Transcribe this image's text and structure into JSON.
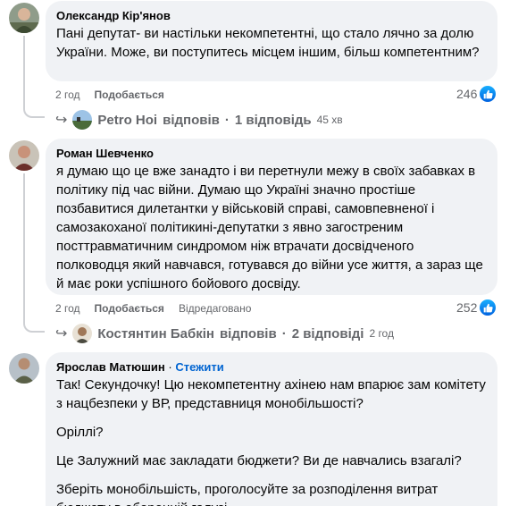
{
  "comments": [
    {
      "author": "Олександр Кір'янов",
      "text": [
        "Пані депутат- ви настільки некомпетентні, що стало лячно за долю України. Може, ви поступитесь місцем іншим, більш компетентним?"
      ],
      "time": "2 год",
      "like_label": "Подобається",
      "reaction_count": "246",
      "replies": {
        "name": "Petro Hoi",
        "replied": "відповів",
        "separator": "·",
        "count": "1 відповідь",
        "time": "45 хв"
      }
    },
    {
      "author": "Роман Шевченко",
      "text": [
        "я думаю що це вже занадто і ви перетнули межу в своїх забавках в політику під час війни. Думаю що Україні значно простіше позбавитися дилетантки у військовій справі, самовпевненої і самозакоханої політикині-депутатки з явно загостреним посттравматичним синдромом ніж втрачати досвідченого полководця який навчався, готувався до війни усе життя, а зараз ще й має роки успішного бойового досвіду."
      ],
      "time": "2 год",
      "like_label": "Подобається",
      "edited_label": "Відредаговано",
      "reaction_count": "252",
      "replies": {
        "name": "Костянтин Бабкін",
        "replied": "відповів",
        "separator": "·",
        "count": "2 відповіді",
        "time": "2 год"
      }
    },
    {
      "author": "Ярослав Матюшин",
      "dot": "·",
      "follow_label": "Стежити",
      "text": [
        "Так! Секундочку! Цю некомпетентну ахінею нам впарює зам комітету з нацбезпеки у ВР, представниця монобільшості?",
        "Оріллі?",
        "Це Залужний має закладати бюджети? Ви де навчались взагалі?",
        "Зберіть монобільшість, проголосуйте за розподілення витрат бюджету в оборонній галузі."
      ]
    }
  ],
  "colors": {
    "bubble": "#f0f2f5",
    "meta": "#65676b",
    "follow": "#0064d1",
    "like_badge": "#1877f2"
  },
  "icons": [
    "avatar-photo",
    "reply-arrow-icon",
    "thumbs-up-icon"
  ]
}
